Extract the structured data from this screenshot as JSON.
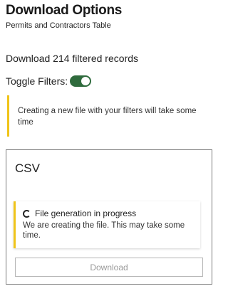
{
  "header": {
    "title": "Download Options",
    "subtitle": "Permits and Contractors Table"
  },
  "records": {
    "label": "Download 214 filtered records"
  },
  "filters": {
    "label": "Toggle Filters:",
    "enabled": true
  },
  "notice": {
    "text": "Creating a new file with your filters will take some time"
  },
  "csv_card": {
    "title": "CSV",
    "progress": {
      "title": "File generation in progress",
      "body": "We are creating the file. This may take some time."
    },
    "download_label": "Download"
  },
  "colors": {
    "toggle_on": "#2f6b3d",
    "notice_accent": "#f0c419",
    "disabled_text": "#9a9a9a"
  }
}
